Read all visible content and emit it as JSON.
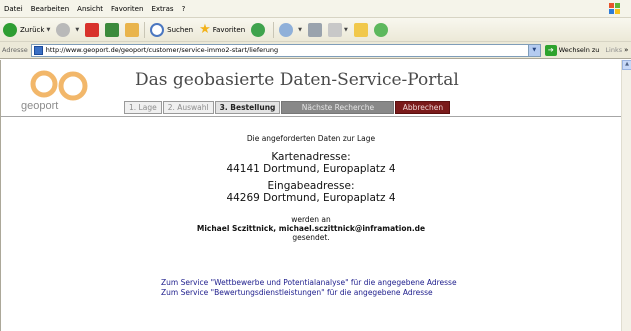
{
  "menu": [
    "Datei",
    "Bearbeiten",
    "Ansicht",
    "Favoriten",
    "Extras",
    "?"
  ],
  "toolbar": {
    "back": "Zurück",
    "search": "Suchen",
    "favorites": "Favoriten"
  },
  "address": {
    "label": "Adresse",
    "url": "http://www.geoport.de/geoport/customer/service-immo2-start/lieferung",
    "go": "Wechseln zu",
    "links": "Links"
  },
  "portal": {
    "logo_text": "geoport",
    "title": "Das geobasierte Daten-Service-Portal",
    "tabs": [
      "1. Lage",
      "2. Auswahl",
      "3. Bestellung",
      "Nächste Recherche",
      "Abbrechen"
    ]
  },
  "delivery": {
    "intro": "Die angeforderten Daten zur Lage",
    "map_label": "Kartenadresse:",
    "map_address": "44141 Dortmund, Europaplatz 4",
    "input_label": "Eingabeadresse:",
    "input_address": "44269 Dortmund, Europaplatz 4",
    "werden": "werden an",
    "recipient": "Michael Sczittnick, michael.sczittnick@inframation.de",
    "gesendet": "gesendet."
  },
  "services": [
    "Zum Service \"Wettbewerbe und Potentialanalyse\" für die angegebene Adresse",
    "Zum Service \"Bewertungsdienstleistungen\" für die angegebene Adresse"
  ]
}
